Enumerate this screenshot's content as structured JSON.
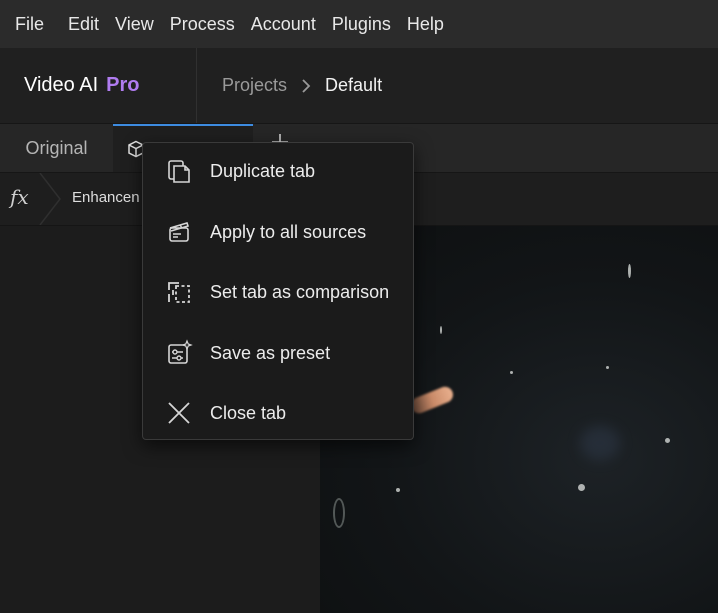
{
  "menubar": {
    "items": [
      "File",
      "Edit",
      "View",
      "Process",
      "Account",
      "Plugins",
      "Help"
    ]
  },
  "header": {
    "app_name": "Video AI",
    "edition": "Pro",
    "breadcrumb": [
      "Projects",
      "Default"
    ]
  },
  "tabs": {
    "original_label": "Original",
    "active_icon": "cube-icon",
    "add_icon": "plus-icon"
  },
  "fxbar": {
    "icon": "fx-icon",
    "label": "Enhancen"
  },
  "context_menu": {
    "items": [
      {
        "label": "Duplicate tab",
        "icon": "duplicate-icon"
      },
      {
        "label": "Apply to all sources",
        "icon": "clapperboard-icon"
      },
      {
        "label": "Set tab as comparison",
        "icon": "compare-icon"
      },
      {
        "label": "Save as preset",
        "icon": "preset-icon"
      },
      {
        "label": "Close tab",
        "icon": "close-icon"
      }
    ]
  },
  "colors": {
    "accent": "#3d8be0",
    "pro": "#b07cf0"
  }
}
